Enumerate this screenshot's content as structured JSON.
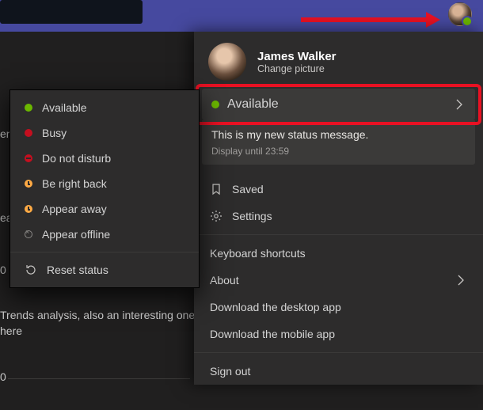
{
  "topbar": {
    "presence": "available"
  },
  "annotation": {
    "arrow_color": "#e81123",
    "highlight_color": "#e81123"
  },
  "background": {
    "frag_en": "en",
    "frag_ea": "ea",
    "trends_line": "Trends analysis, also an interesting one here",
    "zero_a": "0",
    "zero_b": "0"
  },
  "profile": {
    "name": "James Walker",
    "change_picture": "Change picture",
    "status": {
      "label": "Available",
      "presence": "available"
    },
    "note_message": "This is my new status message.",
    "note_until": "Display until 23:59",
    "items": {
      "saved": "Saved",
      "settings": "Settings",
      "shortcuts": "Keyboard shortcuts",
      "about": "About",
      "download_desktop": "Download the desktop app",
      "download_mobile": "Download the mobile app",
      "sign_out": "Sign out"
    }
  },
  "status_menu": {
    "items": [
      {
        "label": "Available",
        "presence": "available"
      },
      {
        "label": "Busy",
        "presence": "busy"
      },
      {
        "label": "Do not disturb",
        "presence": "dnd"
      },
      {
        "label": "Be right back",
        "presence": "brb"
      },
      {
        "label": "Appear away",
        "presence": "away"
      },
      {
        "label": "Appear offline",
        "presence": "offline"
      }
    ],
    "reset": "Reset status"
  }
}
